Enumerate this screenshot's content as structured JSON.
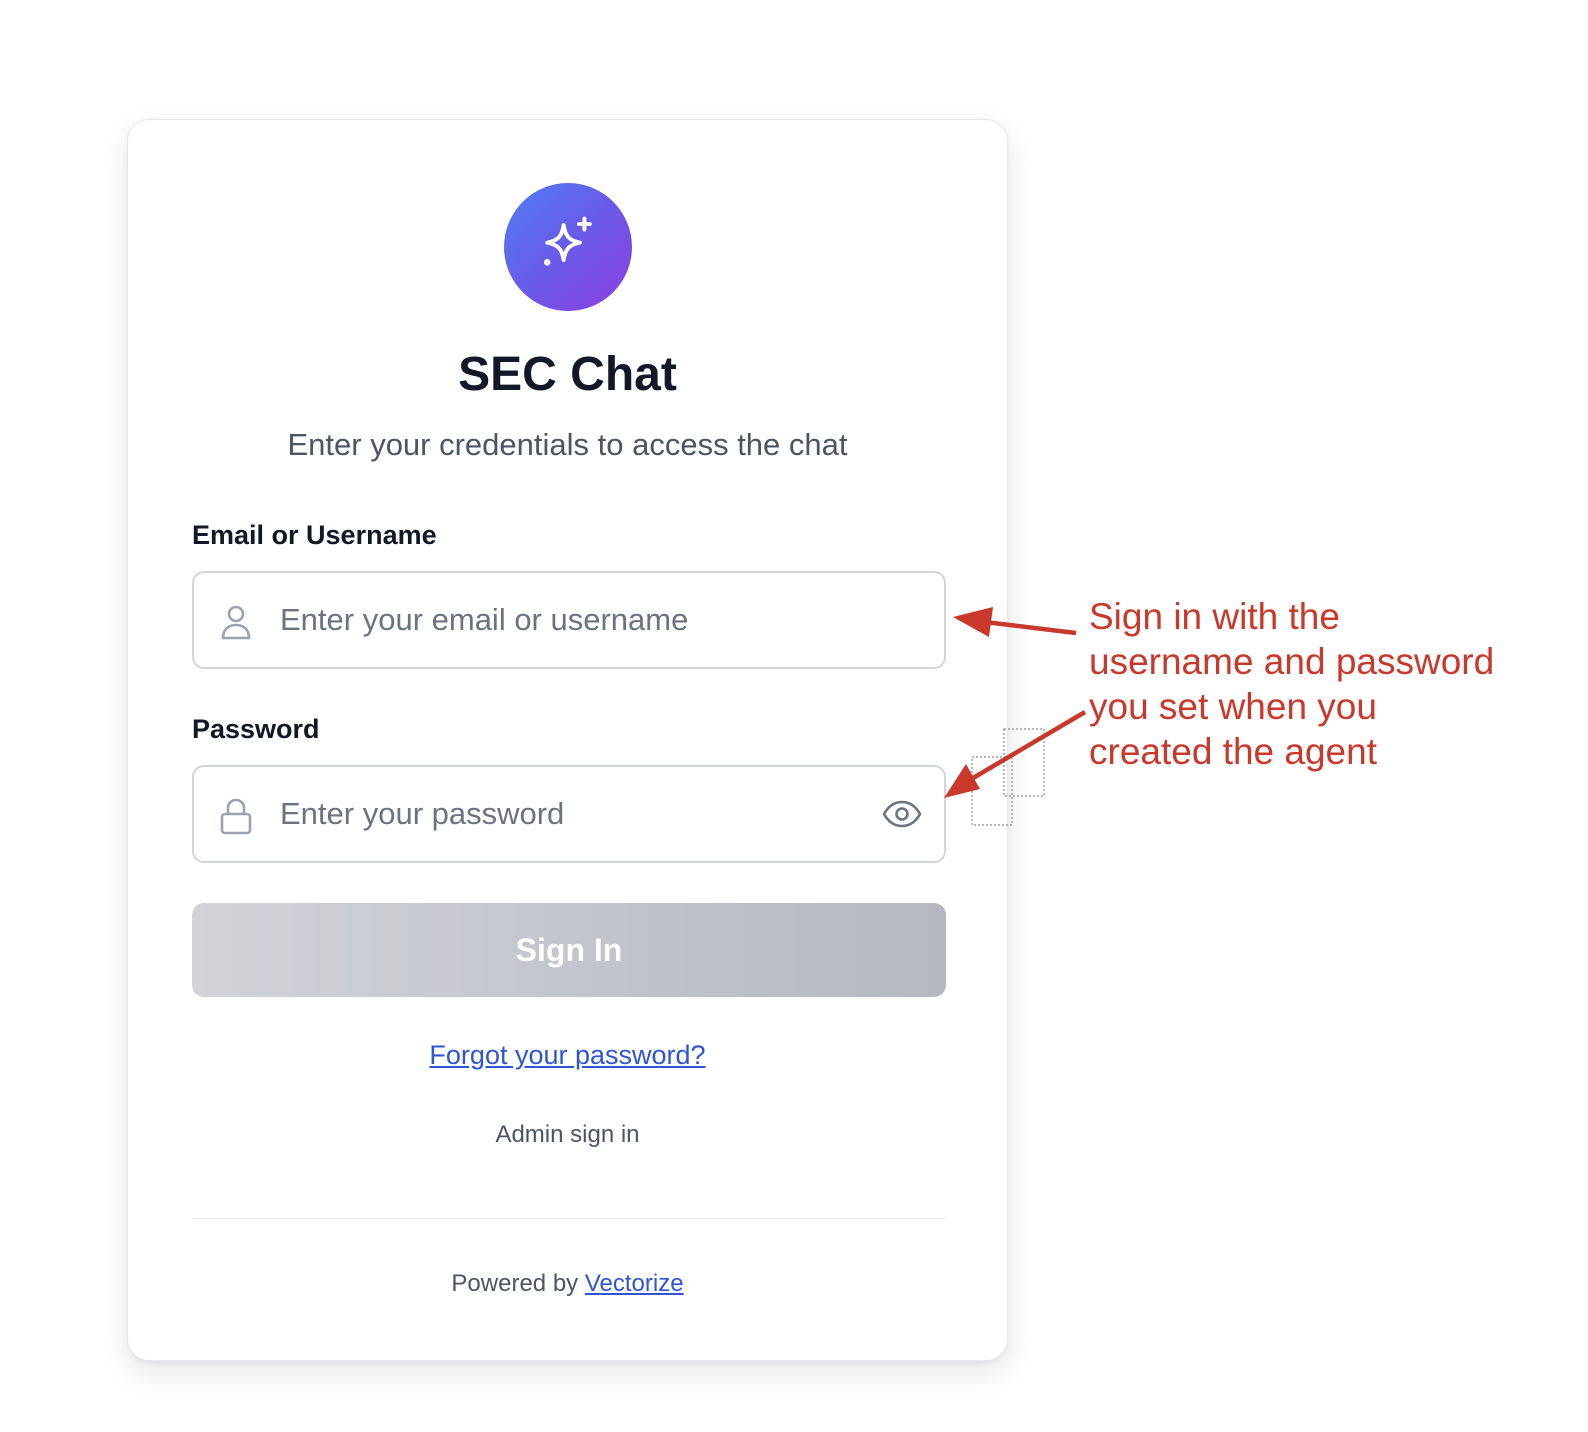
{
  "app": {
    "title": "SEC Chat",
    "subtitle": "Enter your credentials to access the chat"
  },
  "logo": {
    "icon": "sparkles-icon",
    "gradient": [
      "#4f7ef2",
      "#8a3fdd"
    ]
  },
  "form": {
    "email": {
      "label": "Email or Username",
      "placeholder": "Enter your email or username",
      "value": "",
      "icon": "user-icon"
    },
    "password": {
      "label": "Password",
      "placeholder": "Enter your password",
      "value": "",
      "icon": "lock-icon",
      "toggle_icon": "eye-icon"
    },
    "submit_label": "Sign In",
    "submit_enabled": false,
    "forgot_label": "Forgot your password?",
    "admin_label": "Admin sign in"
  },
  "footer": {
    "prefix": "Powered by",
    "link": "Vectorize"
  },
  "annotation": {
    "lines": [
      "Sign in with the",
      "username and password",
      "you set when you",
      "created the agent"
    ],
    "color": "#c8382b"
  },
  "colors": {
    "link": "#2f55d4",
    "button_disabled": "#b5b8c0",
    "text_primary": "#111827",
    "text_muted": "#4b5563"
  }
}
